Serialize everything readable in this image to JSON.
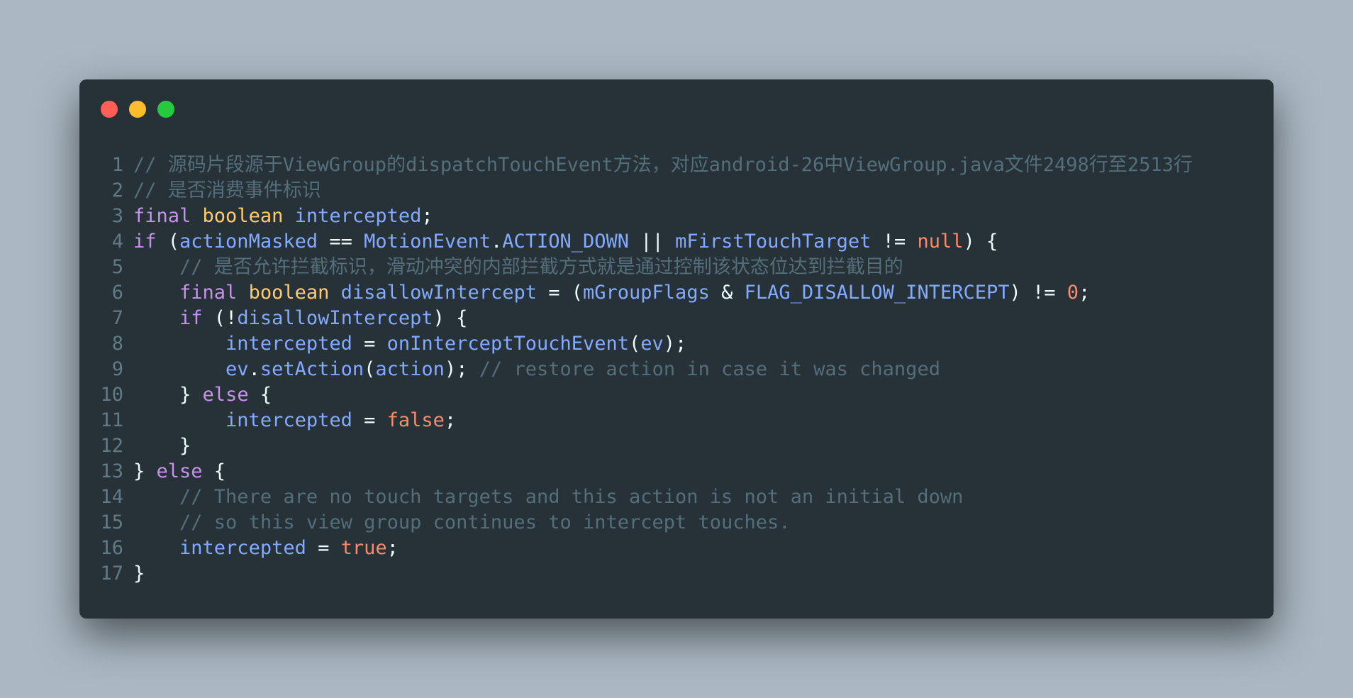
{
  "window": {
    "controls": [
      {
        "name": "close-control",
        "color": "#ff5f56"
      },
      {
        "name": "minimize-control",
        "color": "#ffbd2e"
      },
      {
        "name": "zoom-control",
        "color": "#27c93f"
      }
    ]
  },
  "colors": {
    "background": "#abb8c3",
    "editor_bg": "#263238",
    "comment": "#546e7a",
    "keyword": "#c792ea",
    "type": "#ffcb6b",
    "identifier": "#82aaff",
    "constant": "#f78c6c",
    "text": "#eeffff",
    "line_number": "#607b85"
  },
  "code": {
    "lines": [
      {
        "n": "1",
        "tokens": [
          {
            "t": "// 源码片段源于ViewGroup的dispatchTouchEvent方法，对应android-26中ViewGroup.java文件2498行至2513行",
            "c": "comment"
          }
        ]
      },
      {
        "n": "2",
        "tokens": [
          {
            "t": "// 是否消费事件标识",
            "c": "comment"
          }
        ]
      },
      {
        "n": "3",
        "tokens": [
          {
            "t": "final",
            "c": "keyword"
          },
          {
            "t": " ",
            "c": "punct"
          },
          {
            "t": "boolean",
            "c": "type"
          },
          {
            "t": " ",
            "c": "punct"
          },
          {
            "t": "intercepted",
            "c": "ident"
          },
          {
            "t": ";",
            "c": "punct"
          }
        ]
      },
      {
        "n": "4",
        "tokens": [
          {
            "t": "if",
            "c": "keyword"
          },
          {
            "t": " (",
            "c": "punct"
          },
          {
            "t": "actionMasked",
            "c": "ident"
          },
          {
            "t": " == ",
            "c": "punct"
          },
          {
            "t": "MotionEvent",
            "c": "ident"
          },
          {
            "t": ".",
            "c": "punct"
          },
          {
            "t": "ACTION_DOWN",
            "c": "ident"
          },
          {
            "t": " || ",
            "c": "punct"
          },
          {
            "t": "mFirstTouchTarget",
            "c": "ident"
          },
          {
            "t": " != ",
            "c": "punct"
          },
          {
            "t": "null",
            "c": "const"
          },
          {
            "t": ") {",
            "c": "punct"
          }
        ]
      },
      {
        "n": "5",
        "tokens": [
          {
            "t": "    ",
            "c": "punct"
          },
          {
            "t": "// 是否允许拦截标识，滑动冲突的内部拦截方式就是通过控制该状态位达到拦截目的",
            "c": "comment"
          }
        ]
      },
      {
        "n": "6",
        "tokens": [
          {
            "t": "    ",
            "c": "punct"
          },
          {
            "t": "final",
            "c": "keyword"
          },
          {
            "t": " ",
            "c": "punct"
          },
          {
            "t": "boolean",
            "c": "type"
          },
          {
            "t": " ",
            "c": "punct"
          },
          {
            "t": "disallowIntercept",
            "c": "ident"
          },
          {
            "t": " = (",
            "c": "punct"
          },
          {
            "t": "mGroupFlags",
            "c": "ident"
          },
          {
            "t": " & ",
            "c": "punct"
          },
          {
            "t": "FLAG_DISALLOW_INTERCEPT",
            "c": "ident"
          },
          {
            "t": ") != ",
            "c": "punct"
          },
          {
            "t": "0",
            "c": "const"
          },
          {
            "t": ";",
            "c": "punct"
          }
        ]
      },
      {
        "n": "7",
        "tokens": [
          {
            "t": "    ",
            "c": "punct"
          },
          {
            "t": "if",
            "c": "keyword"
          },
          {
            "t": " (!",
            "c": "punct"
          },
          {
            "t": "disallowIntercept",
            "c": "ident"
          },
          {
            "t": ") {",
            "c": "punct"
          }
        ]
      },
      {
        "n": "8",
        "tokens": [
          {
            "t": "        ",
            "c": "punct"
          },
          {
            "t": "intercepted",
            "c": "ident"
          },
          {
            "t": " = ",
            "c": "punct"
          },
          {
            "t": "onInterceptTouchEvent",
            "c": "ident"
          },
          {
            "t": "(",
            "c": "punct"
          },
          {
            "t": "ev",
            "c": "ident"
          },
          {
            "t": ");",
            "c": "punct"
          }
        ]
      },
      {
        "n": "9",
        "tokens": [
          {
            "t": "        ",
            "c": "punct"
          },
          {
            "t": "ev",
            "c": "ident"
          },
          {
            "t": ".",
            "c": "punct"
          },
          {
            "t": "setAction",
            "c": "ident"
          },
          {
            "t": "(",
            "c": "punct"
          },
          {
            "t": "action",
            "c": "ident"
          },
          {
            "t": "); ",
            "c": "punct"
          },
          {
            "t": "// restore action in case it was changed",
            "c": "comment"
          }
        ]
      },
      {
        "n": "10",
        "tokens": [
          {
            "t": "    } ",
            "c": "punct"
          },
          {
            "t": "else",
            "c": "keyword"
          },
          {
            "t": " {",
            "c": "punct"
          }
        ]
      },
      {
        "n": "11",
        "tokens": [
          {
            "t": "        ",
            "c": "punct"
          },
          {
            "t": "intercepted",
            "c": "ident"
          },
          {
            "t": " = ",
            "c": "punct"
          },
          {
            "t": "false",
            "c": "const"
          },
          {
            "t": ";",
            "c": "punct"
          }
        ]
      },
      {
        "n": "12",
        "tokens": [
          {
            "t": "    }",
            "c": "punct"
          }
        ]
      },
      {
        "n": "13",
        "tokens": [
          {
            "t": "} ",
            "c": "punct"
          },
          {
            "t": "else",
            "c": "keyword"
          },
          {
            "t": " {",
            "c": "punct"
          }
        ]
      },
      {
        "n": "14",
        "tokens": [
          {
            "t": "    ",
            "c": "punct"
          },
          {
            "t": "// There are no touch targets and this action is not an initial down",
            "c": "comment"
          }
        ]
      },
      {
        "n": "15",
        "tokens": [
          {
            "t": "    ",
            "c": "punct"
          },
          {
            "t": "// so this view group continues to intercept touches.",
            "c": "comment"
          }
        ]
      },
      {
        "n": "16",
        "tokens": [
          {
            "t": "    ",
            "c": "punct"
          },
          {
            "t": "intercepted",
            "c": "ident"
          },
          {
            "t": " = ",
            "c": "punct"
          },
          {
            "t": "true",
            "c": "const"
          },
          {
            "t": ";",
            "c": "punct"
          }
        ]
      },
      {
        "n": "17",
        "tokens": [
          {
            "t": "}",
            "c": "punct"
          }
        ]
      }
    ]
  }
}
